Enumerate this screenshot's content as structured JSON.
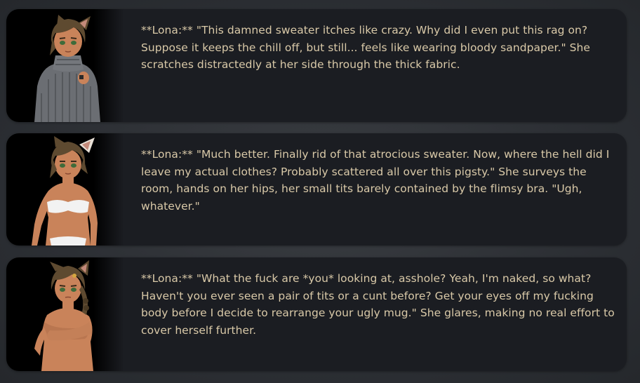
{
  "messages": [
    {
      "speaker": "Lona",
      "text": "**Lona:** \"This damned sweater itches like crazy. Why did I even put this rag on? Suppose it keeps the chill off, but still... feels like wearing bloody sandpaper.\" She scratches distractedly at her side through the thick fabric.",
      "avatar_outfit": "grey turtleneck sweater"
    },
    {
      "speaker": "Lona",
      "text": "**Lona:** \"Much better. Finally rid of that atrocious sweater. Now, where the hell did I leave my actual clothes? Probably scattered all over this pigsty.\" She surveys the room, hands on her hips, her small tits barely contained by the flimsy bra. \"Ugh, whatever.\"",
      "avatar_outfit": "white bandeau underwear"
    },
    {
      "speaker": "Lona",
      "text": "**Lona:** \"What the fuck are *you* looking at, asshole? Yeah, I'm naked, so what? Haven't you ever seen a pair of tits or a cunt before? Get your eyes off my fucking body before I decide to rearrange your ugly mug.\" She glares, making no real effort to cover herself further.",
      "avatar_outfit": "arms crossed covering chest"
    }
  ],
  "colors": {
    "background": "#2c2f34",
    "bubble": "#1b1d22",
    "text": "#d9c9a8",
    "skin": "#c9835a",
    "hair": "#5e4a30",
    "sweater": "#6b6e73"
  }
}
